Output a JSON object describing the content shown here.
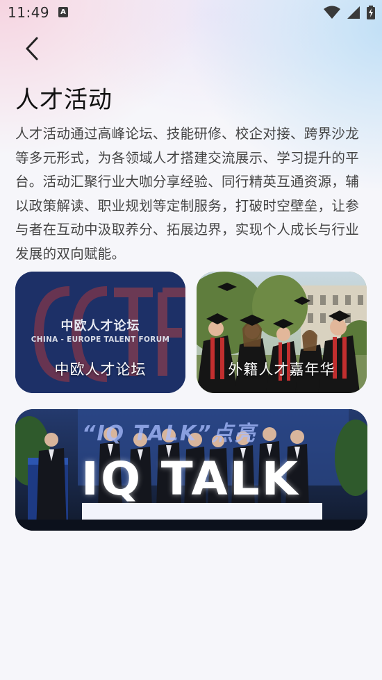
{
  "status_bar": {
    "time": "11:49",
    "notification_icon": "A"
  },
  "header": {
    "back_icon": "chevron-left-icon",
    "title": "人才活动"
  },
  "intro": "人才活动通过高峰论坛、技能研修、校企对接、跨界沙龙等多元形式，为各领域人才搭建交流展示、学习提升的平台。活动汇聚行业大咖分享经验、同行精英互通资源，辅以政策解读、职业规划等定制服务，打破时空壁垒，让参与者在互动中汲取养分、拓展边界，实现个人成长与行业发展的双向赋能。",
  "cards": [
    {
      "caption": "中欧人才论坛",
      "logo_cn": "中欧人才论坛",
      "logo_en": "CHINA - EUROPE TALENT FORUM",
      "logo_letters": "CCTF"
    },
    {
      "caption": "外籍人才嘉年华"
    },
    {
      "caption": "",
      "banner_title": "“IQ TALK”点亮",
      "stage_text": "IQ TALK"
    }
  ],
  "colors": {
    "forum_bg": "#1e3068",
    "forum_accent": "#c8332f",
    "iq_bg": "#1c2638"
  }
}
